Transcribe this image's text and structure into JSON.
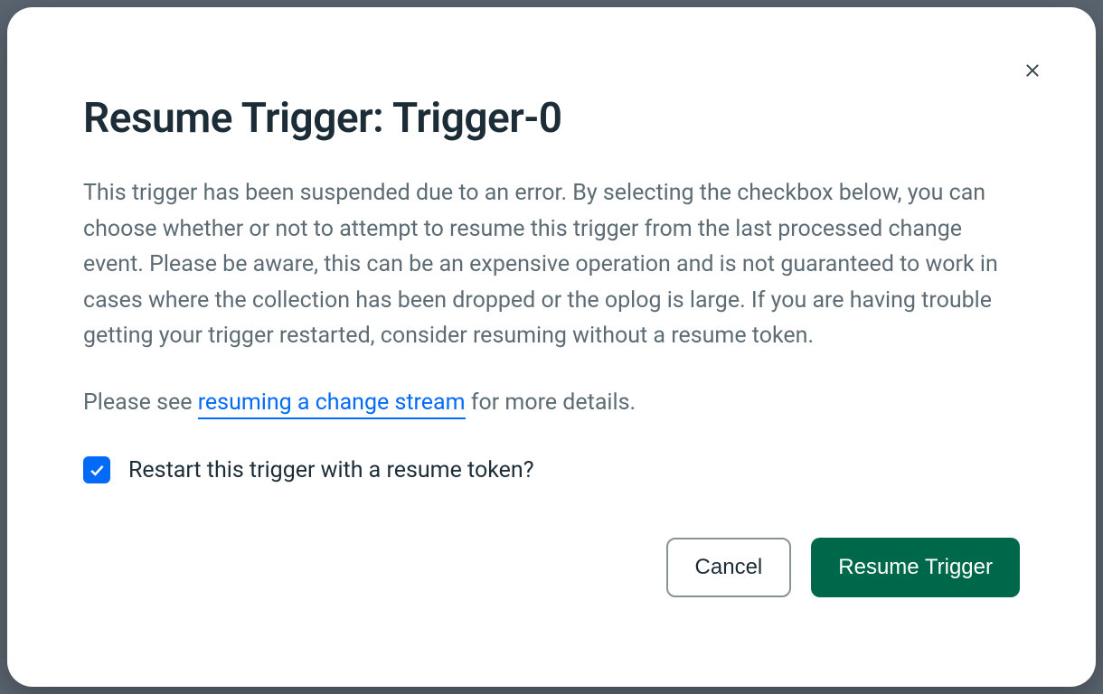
{
  "modal": {
    "title": "Resume Trigger: Trigger-0",
    "body_text": "This trigger has been suspended due to an error. By selecting the checkbox below, you can choose whether or not to attempt to resume this trigger from the last processed change event. Please be aware, this can be an expensive operation and is not guaranteed to work in cases where the collection has been dropped or the oplog is large. If you are having trouble getting your trigger restarted, consider resuming without a resume token.",
    "secondary_prefix": "Please see ",
    "link_text": "resuming a change stream",
    "secondary_suffix": " for more details.",
    "checkbox_label": "Restart this trigger with a resume token?",
    "checkbox_checked": true,
    "cancel_label": "Cancel",
    "confirm_label": "Resume Trigger"
  }
}
